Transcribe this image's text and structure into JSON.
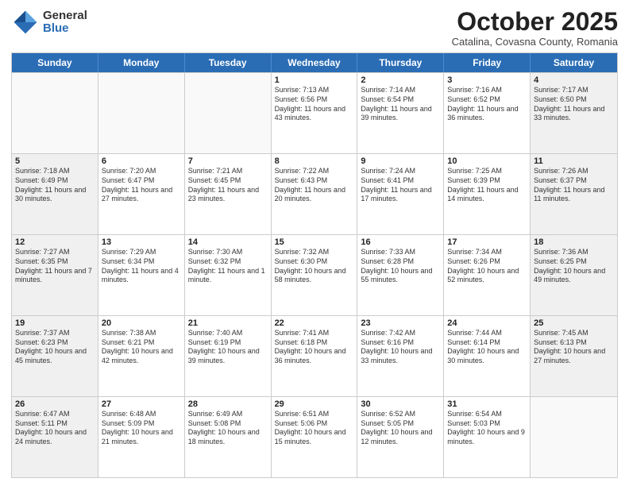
{
  "logo": {
    "general": "General",
    "blue": "Blue"
  },
  "title": "October 2025",
  "location": "Catalina, Covasna County, Romania",
  "days": [
    "Sunday",
    "Monday",
    "Tuesday",
    "Wednesday",
    "Thursday",
    "Friday",
    "Saturday"
  ],
  "weeks": [
    [
      {
        "num": "",
        "text": "",
        "empty": true
      },
      {
        "num": "",
        "text": "",
        "empty": true
      },
      {
        "num": "",
        "text": "",
        "empty": true
      },
      {
        "num": "1",
        "text": "Sunrise: 7:13 AM\nSunset: 6:56 PM\nDaylight: 11 hours and 43 minutes.",
        "empty": false
      },
      {
        "num": "2",
        "text": "Sunrise: 7:14 AM\nSunset: 6:54 PM\nDaylight: 11 hours and 39 minutes.",
        "empty": false
      },
      {
        "num": "3",
        "text": "Sunrise: 7:16 AM\nSunset: 6:52 PM\nDaylight: 11 hours and 36 minutes.",
        "empty": false
      },
      {
        "num": "4",
        "text": "Sunrise: 7:17 AM\nSunset: 6:50 PM\nDaylight: 11 hours and 33 minutes.",
        "empty": false,
        "shaded": true
      }
    ],
    [
      {
        "num": "5",
        "text": "Sunrise: 7:18 AM\nSunset: 6:49 PM\nDaylight: 11 hours and 30 minutes.",
        "empty": false,
        "shaded": true
      },
      {
        "num": "6",
        "text": "Sunrise: 7:20 AM\nSunset: 6:47 PM\nDaylight: 11 hours and 27 minutes.",
        "empty": false
      },
      {
        "num": "7",
        "text": "Sunrise: 7:21 AM\nSunset: 6:45 PM\nDaylight: 11 hours and 23 minutes.",
        "empty": false
      },
      {
        "num": "8",
        "text": "Sunrise: 7:22 AM\nSunset: 6:43 PM\nDaylight: 11 hours and 20 minutes.",
        "empty": false
      },
      {
        "num": "9",
        "text": "Sunrise: 7:24 AM\nSunset: 6:41 PM\nDaylight: 11 hours and 17 minutes.",
        "empty": false
      },
      {
        "num": "10",
        "text": "Sunrise: 7:25 AM\nSunset: 6:39 PM\nDaylight: 11 hours and 14 minutes.",
        "empty": false
      },
      {
        "num": "11",
        "text": "Sunrise: 7:26 AM\nSunset: 6:37 PM\nDaylight: 11 hours and 11 minutes.",
        "empty": false,
        "shaded": true
      }
    ],
    [
      {
        "num": "12",
        "text": "Sunrise: 7:27 AM\nSunset: 6:35 PM\nDaylight: 11 hours and 7 minutes.",
        "empty": false,
        "shaded": true
      },
      {
        "num": "13",
        "text": "Sunrise: 7:29 AM\nSunset: 6:34 PM\nDaylight: 11 hours and 4 minutes.",
        "empty": false
      },
      {
        "num": "14",
        "text": "Sunrise: 7:30 AM\nSunset: 6:32 PM\nDaylight: 11 hours and 1 minute.",
        "empty": false
      },
      {
        "num": "15",
        "text": "Sunrise: 7:32 AM\nSunset: 6:30 PM\nDaylight: 10 hours and 58 minutes.",
        "empty": false
      },
      {
        "num": "16",
        "text": "Sunrise: 7:33 AM\nSunset: 6:28 PM\nDaylight: 10 hours and 55 minutes.",
        "empty": false
      },
      {
        "num": "17",
        "text": "Sunrise: 7:34 AM\nSunset: 6:26 PM\nDaylight: 10 hours and 52 minutes.",
        "empty": false
      },
      {
        "num": "18",
        "text": "Sunrise: 7:36 AM\nSunset: 6:25 PM\nDaylight: 10 hours and 49 minutes.",
        "empty": false,
        "shaded": true
      }
    ],
    [
      {
        "num": "19",
        "text": "Sunrise: 7:37 AM\nSunset: 6:23 PM\nDaylight: 10 hours and 45 minutes.",
        "empty": false,
        "shaded": true
      },
      {
        "num": "20",
        "text": "Sunrise: 7:38 AM\nSunset: 6:21 PM\nDaylight: 10 hours and 42 minutes.",
        "empty": false
      },
      {
        "num": "21",
        "text": "Sunrise: 7:40 AM\nSunset: 6:19 PM\nDaylight: 10 hours and 39 minutes.",
        "empty": false
      },
      {
        "num": "22",
        "text": "Sunrise: 7:41 AM\nSunset: 6:18 PM\nDaylight: 10 hours and 36 minutes.",
        "empty": false
      },
      {
        "num": "23",
        "text": "Sunrise: 7:42 AM\nSunset: 6:16 PM\nDaylight: 10 hours and 33 minutes.",
        "empty": false
      },
      {
        "num": "24",
        "text": "Sunrise: 7:44 AM\nSunset: 6:14 PM\nDaylight: 10 hours and 30 minutes.",
        "empty": false
      },
      {
        "num": "25",
        "text": "Sunrise: 7:45 AM\nSunset: 6:13 PM\nDaylight: 10 hours and 27 minutes.",
        "empty": false,
        "shaded": true
      }
    ],
    [
      {
        "num": "26",
        "text": "Sunrise: 6:47 AM\nSunset: 5:11 PM\nDaylight: 10 hours and 24 minutes.",
        "empty": false,
        "shaded": true
      },
      {
        "num": "27",
        "text": "Sunrise: 6:48 AM\nSunset: 5:09 PM\nDaylight: 10 hours and 21 minutes.",
        "empty": false
      },
      {
        "num": "28",
        "text": "Sunrise: 6:49 AM\nSunset: 5:08 PM\nDaylight: 10 hours and 18 minutes.",
        "empty": false
      },
      {
        "num": "29",
        "text": "Sunrise: 6:51 AM\nSunset: 5:06 PM\nDaylight: 10 hours and 15 minutes.",
        "empty": false
      },
      {
        "num": "30",
        "text": "Sunrise: 6:52 AM\nSunset: 5:05 PM\nDaylight: 10 hours and 12 minutes.",
        "empty": false
      },
      {
        "num": "31",
        "text": "Sunrise: 6:54 AM\nSunset: 5:03 PM\nDaylight: 10 hours and 9 minutes.",
        "empty": false
      },
      {
        "num": "",
        "text": "",
        "empty": true
      }
    ]
  ]
}
